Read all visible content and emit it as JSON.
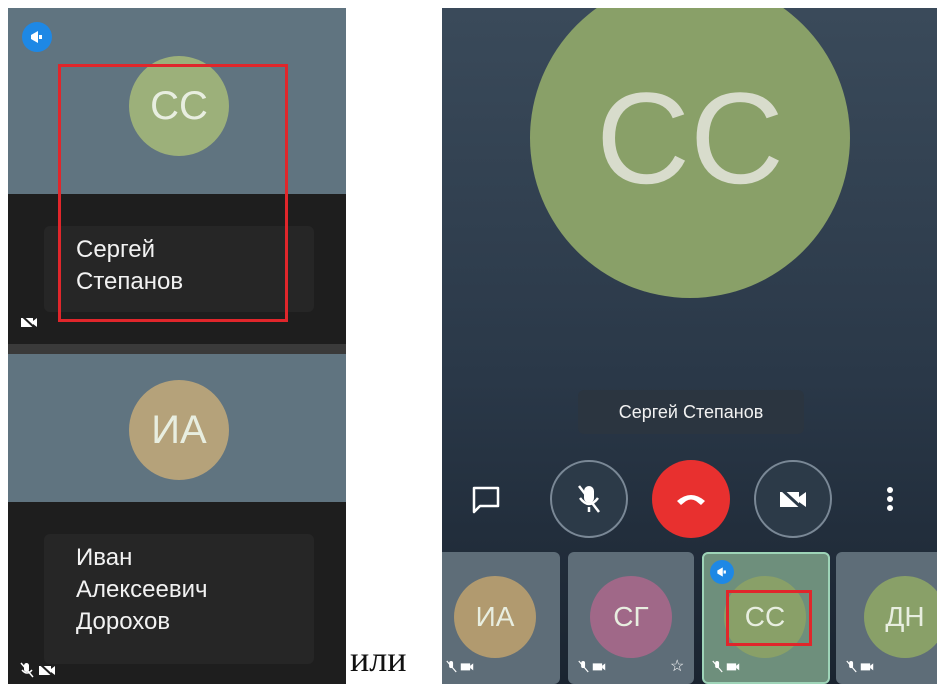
{
  "left": {
    "top_tile": {
      "initials": "СС",
      "name_line1": "Сергей",
      "name_line2": "Степанов",
      "avatar_color": "#9cb07a"
    },
    "bottom_tile": {
      "initials": "ИА",
      "name_line1": "Иван",
      "name_line2": "Алексеевич",
      "name_line3": "Дорохов",
      "avatar_color": "#b5a27a"
    }
  },
  "separator_text": "или",
  "right": {
    "main_avatar": {
      "initials": "СС",
      "color": "#89a068"
    },
    "speaker_name": "Сергей Степанов",
    "participants": [
      {
        "initials": "ИА",
        "color": "#b19a6f"
      },
      {
        "initials": "СГ",
        "color": "#a06888"
      },
      {
        "initials": "СС",
        "color": "#89a068"
      },
      {
        "initials": "ДН",
        "color": "#89a068"
      }
    ]
  },
  "colors": {
    "accent": "#1e88e5",
    "end_call": "#e8302f",
    "highlight": "#e0262b"
  }
}
